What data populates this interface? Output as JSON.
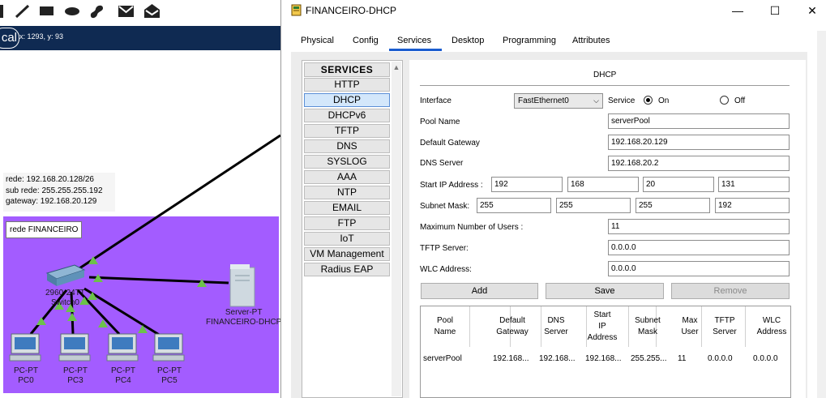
{
  "toolbar": {
    "icons": [
      "cursor-icon",
      "line-tool-icon",
      "rectangle-tool-icon",
      "ellipse-tool-icon",
      "freeform-tool-icon",
      "envelope-icon",
      "open-envelope-icon"
    ]
  },
  "workspace": {
    "mode_tab": "cal",
    "coords": "x: 1293, y: 93",
    "note_lines": [
      "rede: 192.168.20.128/26",
      "sub rede: 255.255.255.192",
      "gateway: 192.168.20.129"
    ],
    "area_label": "rede FINANCEIRO",
    "switch_label_line1": "2960-24TT",
    "switch_label_line2": "Switch0",
    "server_label_line1": "Server-PT",
    "server_label_line2": "FINANCEIRO-DHCP",
    "pcs": [
      {
        "type": "PC-PT",
        "name": "PC0"
      },
      {
        "type": "PC-PT",
        "name": "PC3"
      },
      {
        "type": "PC-PT",
        "name": "PC4"
      },
      {
        "type": "PC-PT",
        "name": "PC5"
      }
    ],
    "area_color": "#a35cff",
    "link_light_color": "#6cc24a"
  },
  "window": {
    "title": "FINANCEIRO-DHCP",
    "minimize": "—",
    "maximize": "☐",
    "close": "✕",
    "tabs": [
      "Physical",
      "Config",
      "Services",
      "Desktop",
      "Programming",
      "Attributes"
    ],
    "active_tab": "Services"
  },
  "services": {
    "header": "SERVICES",
    "items": [
      "HTTP",
      "DHCP",
      "DHCPv6",
      "TFTP",
      "DNS",
      "SYSLOG",
      "AAA",
      "NTP",
      "EMAIL",
      "FTP",
      "IoT",
      "VM Management",
      "Radius EAP"
    ],
    "selected": "DHCP"
  },
  "dhcp": {
    "title": "DHCP",
    "interface_label": "Interface",
    "interface_value": "FastEthernet0",
    "service_label": "Service",
    "on_label": "On",
    "off_label": "Off",
    "service_on": true,
    "pool_name_label": "Pool Name",
    "pool_name": "serverPool",
    "gateway_label": "Default Gateway",
    "gateway": "192.168.20.129",
    "dns_label": "DNS Server",
    "dns": "192.168.20.2",
    "start_ip_label": "Start IP Address :",
    "start_ip": [
      "192",
      "168",
      "20",
      "131"
    ],
    "mask_label": "Subnet Mask:",
    "mask": [
      "255",
      "255",
      "255",
      "192"
    ],
    "max_users_label": "Maximum Number of Users :",
    "max_users": "11",
    "tftp_label": "TFTP Server:",
    "tftp": "0.0.0.0",
    "wlc_label": "WLC Address:",
    "wlc": "0.0.0.0",
    "add": "Add",
    "save": "Save",
    "remove": "Remove"
  },
  "pool_table": {
    "headers": [
      [
        "Pool",
        "Name"
      ],
      [
        "Default",
        "Gateway"
      ],
      [
        "DNS",
        "Server"
      ],
      [
        "Start",
        "IP",
        "Address"
      ],
      [
        "Subnet",
        "Mask"
      ],
      [
        "Max",
        "User"
      ],
      [
        "TFTP",
        "Server"
      ],
      [
        "WLC",
        "Address"
      ]
    ],
    "rows": [
      [
        "serverPool",
        "192.168...",
        "192.168...",
        "192.168...",
        "255.255...",
        "11",
        "0.0.0.0",
        "0.0.0.0"
      ]
    ]
  }
}
